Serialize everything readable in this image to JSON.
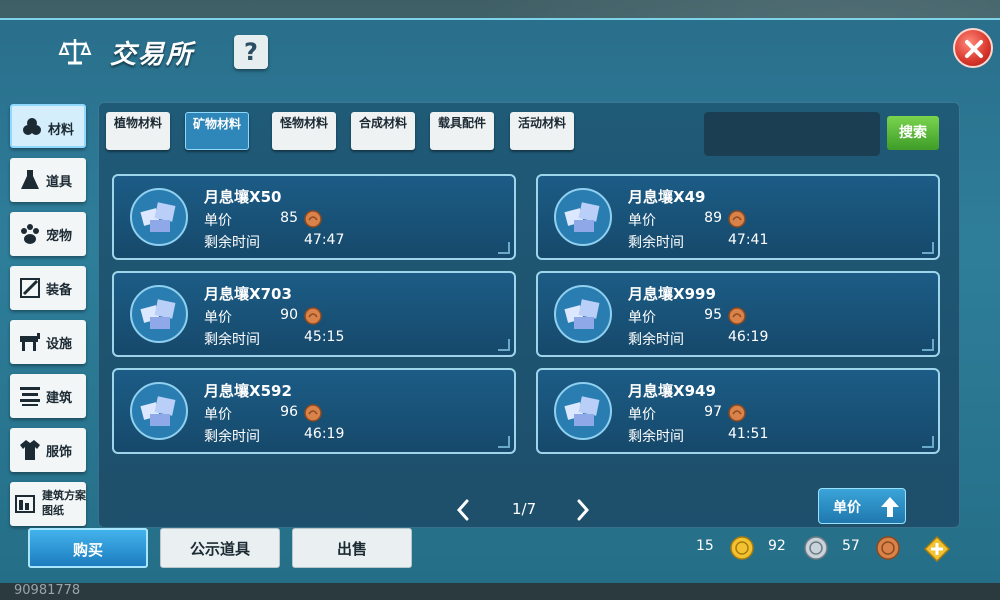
{
  "window": {
    "title": "交易所",
    "help_label": "?"
  },
  "sidebar": {
    "items": [
      {
        "label": "材料",
        "icon": "materials-icon",
        "active": true
      },
      {
        "label": "道具",
        "icon": "flask-icon",
        "active": false
      },
      {
        "label": "宠物",
        "icon": "paw-icon",
        "active": false
      },
      {
        "label": "装备",
        "icon": "sword-icon",
        "active": false
      },
      {
        "label": "设施",
        "icon": "facility-icon",
        "active": false
      },
      {
        "label": "建筑",
        "icon": "building-icon",
        "active": false
      },
      {
        "label": "服饰",
        "icon": "clothing-icon",
        "active": false
      },
      {
        "label": "建筑方案图纸",
        "icon": "blueprint-icon",
        "active": false
      }
    ]
  },
  "tabs": [
    {
      "label": "植物材料",
      "active": false
    },
    {
      "label": "矿物材料",
      "active": true
    },
    {
      "label": "怪物材料",
      "active": false
    },
    {
      "label": "合成材料",
      "active": false
    },
    {
      "label": "载具配件",
      "active": false
    },
    {
      "label": "活动材料",
      "active": false
    }
  ],
  "search": {
    "button_label": "搜索",
    "value": ""
  },
  "listing_labels": {
    "price": "单价",
    "time": "剩余时间"
  },
  "listings": [
    {
      "name": "月息壤X50",
      "price": "85",
      "time": "47:47"
    },
    {
      "name": "月息壤X49",
      "price": "89",
      "time": "47:41"
    },
    {
      "name": "月息壤X703",
      "price": "90",
      "time": "45:15"
    },
    {
      "name": "月息壤X999",
      "price": "95",
      "time": "46:19"
    },
    {
      "name": "月息壤X592",
      "price": "96",
      "time": "46:19"
    },
    {
      "name": "月息壤X949",
      "price": "97",
      "time": "41:51"
    }
  ],
  "pager": {
    "page": "1/7"
  },
  "sort": {
    "label": "单价"
  },
  "actions": {
    "buy": "购买",
    "publicize": "公示道具",
    "sell": "出售"
  },
  "currency": {
    "gold": "15",
    "silver": "92",
    "copper": "57"
  },
  "colors": {
    "gold": "#f2c230",
    "silver": "#c9d3da",
    "copper": "#d9824a",
    "accent": "#2f86b8"
  },
  "footer": {
    "id": "90981778"
  }
}
